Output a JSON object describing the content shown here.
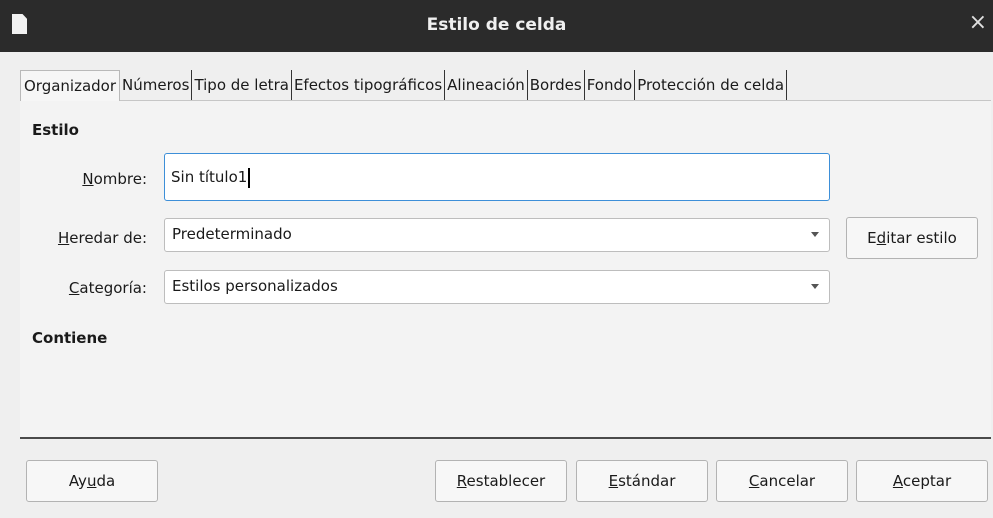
{
  "window": {
    "title": "Estilo de celda",
    "close_glyph": "×"
  },
  "tabs": [
    {
      "label": "Organizador",
      "active": true
    },
    {
      "label": "Números"
    },
    {
      "label": "Tipo de letra"
    },
    {
      "label": "Efectos tipográficos"
    },
    {
      "label": "Alineación"
    },
    {
      "label": "Bordes"
    },
    {
      "label": "Fondo"
    },
    {
      "label": "Protección de celda"
    }
  ],
  "estilo": {
    "section_title": "Estilo",
    "nombre": {
      "label_mnemonic": "N",
      "label_rest": "ombre:",
      "value": "Sin título1"
    },
    "heredar": {
      "label_mnemonic": "H",
      "label_rest": "eredar de:",
      "value": "Predeterminado"
    },
    "categoria": {
      "label_mnemonic": "C",
      "label_rest": "ategoría:",
      "value": "Estilos personalizados"
    },
    "editar_button": {
      "pre": "E",
      "mnemonic": "d",
      "post": "itar estilo"
    }
  },
  "contiene": {
    "section_title": "Contiene"
  },
  "buttons": {
    "ayuda": {
      "pre": "Ay",
      "mnemonic": "u",
      "post": "da"
    },
    "restablecer": {
      "pre": "",
      "mnemonic": "R",
      "post": "establecer"
    },
    "estandar": {
      "pre": "",
      "mnemonic": "E",
      "post": "stándar"
    },
    "cancelar": {
      "pre": "",
      "mnemonic": "C",
      "post": "ancelar"
    },
    "aceptar": {
      "pre": "",
      "mnemonic": "A",
      "post": "ceptar"
    }
  }
}
